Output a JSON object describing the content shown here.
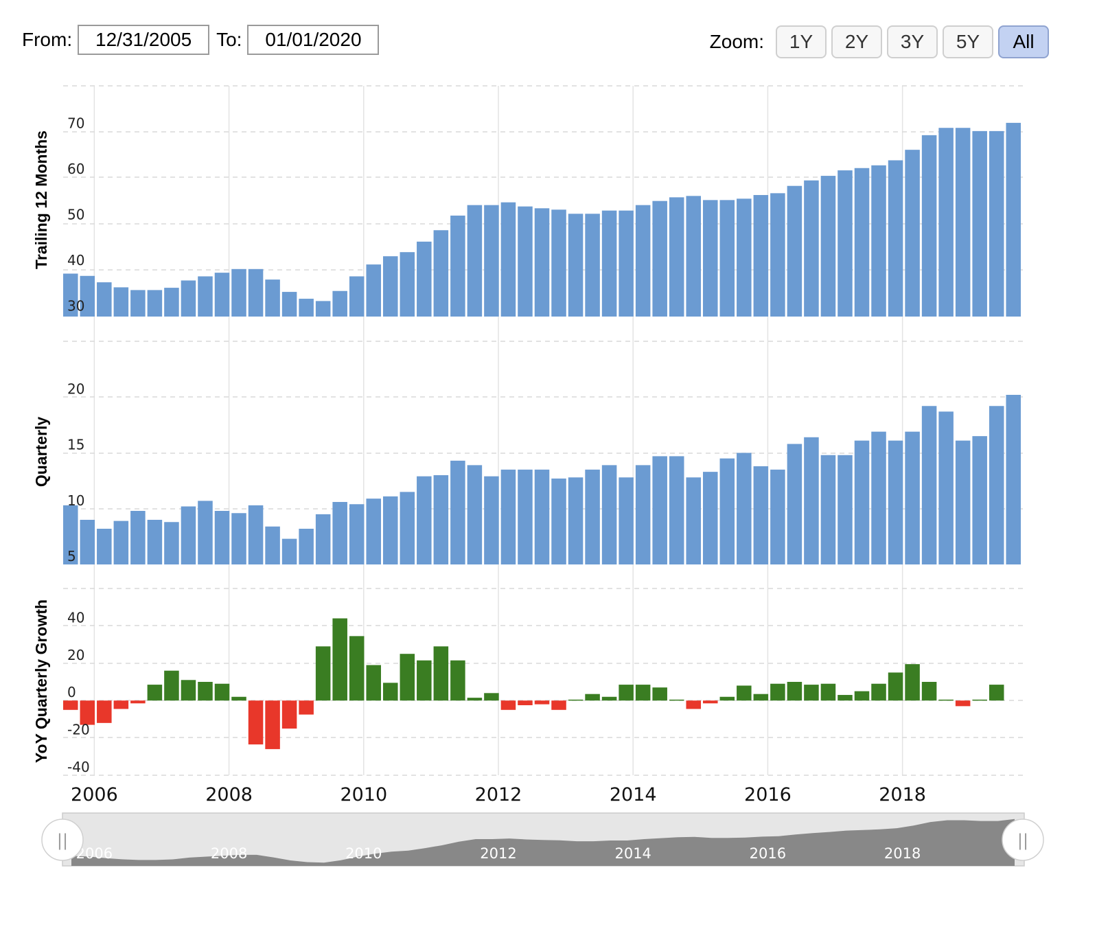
{
  "range": {
    "from_label": "From:",
    "from_value": "12/31/2005",
    "to_label": "To:",
    "to_value": "01/01/2020"
  },
  "zoom": {
    "label": "Zoom:",
    "buttons": [
      "1Y",
      "2Y",
      "3Y",
      "5Y",
      "All"
    ],
    "active": "All"
  },
  "colors": {
    "bar_blue": "#6b9bd2",
    "growth_positive": "#3a7d22",
    "growth_negative": "#e8372a",
    "grid": "#d9d9d9",
    "navigator_fill": "#888888",
    "navigator_bg": "#e6e6e6"
  },
  "chart_data": [
    {
      "type": "bar",
      "ylabel": "Trailing 12 Months",
      "yticks": [
        30,
        40,
        50,
        60,
        70
      ],
      "ylim": [
        29.5,
        80
      ],
      "grid": true,
      "x_start": "2006-Q1",
      "x_ticks": [
        "2006",
        "2008",
        "2010",
        "2012",
        "2014",
        "2016",
        "2018"
      ],
      "values": [
        38.9,
        38.4,
        37.0,
        35.9,
        35.3,
        35.3,
        35.8,
        37.4,
        38.3,
        39.1,
        39.9,
        39.9,
        37.6,
        34.9,
        33.4,
        32.9,
        35.1,
        38.3,
        40.9,
        42.7,
        43.6,
        45.9,
        48.4,
        51.6,
        53.9,
        53.9,
        54.5,
        53.6,
        53.2,
        52.9,
        52.0,
        52.0,
        52.7,
        52.7,
        53.9,
        54.8,
        55.6,
        55.9,
        55.0,
        55.0,
        55.3,
        56.1,
        56.5,
        58.1,
        59.3,
        60.3,
        61.5,
        62.0,
        62.6,
        63.7,
        66.0,
        69.2,
        70.8,
        70.8,
        70.1,
        70.1,
        71.9
      ]
    },
    {
      "type": "bar",
      "ylabel": "Quarterly",
      "yticks": [
        5,
        10,
        15,
        20
      ],
      "ylim": [
        5,
        25
      ],
      "grid": true,
      "x_start": "2006-Q1",
      "values": [
        10.3,
        9.0,
        8.2,
        8.9,
        9.8,
        9.0,
        8.8,
        10.2,
        10.7,
        9.8,
        9.6,
        10.3,
        8.4,
        7.3,
        8.2,
        9.5,
        10.6,
        10.4,
        10.9,
        11.1,
        11.5,
        12.9,
        13.0,
        14.3,
        13.9,
        12.9,
        13.5,
        13.5,
        13.5,
        12.7,
        12.8,
        13.5,
        13.9,
        12.8,
        13.9,
        14.7,
        14.7,
        12.8,
        13.3,
        14.5,
        15.0,
        13.8,
        13.5,
        15.8,
        16.4,
        14.8,
        14.8,
        16.1,
        16.9,
        16.1,
        16.9,
        19.2,
        18.7,
        16.1,
        16.5,
        19.2,
        20.2
      ]
    },
    {
      "type": "bar",
      "ylabel": "YoY Quarterly Growth",
      "yticks": [
        -40,
        20,
        0,
        -20,
        40
      ],
      "ylim": [
        -40,
        60
      ],
      "grid": true,
      "x_start": "2006-Q1",
      "values": [
        -5,
        -13,
        -12,
        -4.5,
        -1.5,
        8.5,
        16,
        11,
        10,
        9,
        2,
        -23.5,
        -26,
        -15,
        -7.5,
        29,
        44,
        34.5,
        19,
        9.5,
        25,
        21.5,
        29,
        21.5,
        1.5,
        4,
        -5,
        -2.5,
        -2,
        -5,
        0.5,
        3.5,
        2,
        8.5,
        8.5,
        7,
        0.5,
        -4.5,
        -1.5,
        2,
        8,
        3.5,
        9,
        10,
        8.5,
        9,
        3,
        5,
        9,
        15,
        19.5,
        10,
        0.5,
        -3,
        0.5,
        8.5
      ]
    }
  ],
  "navigator": {
    "labels": [
      "2006",
      "2008",
      "2010",
      "2012",
      "2014",
      "2016",
      "2018"
    ],
    "left_handle": "||",
    "right_handle": "||"
  }
}
